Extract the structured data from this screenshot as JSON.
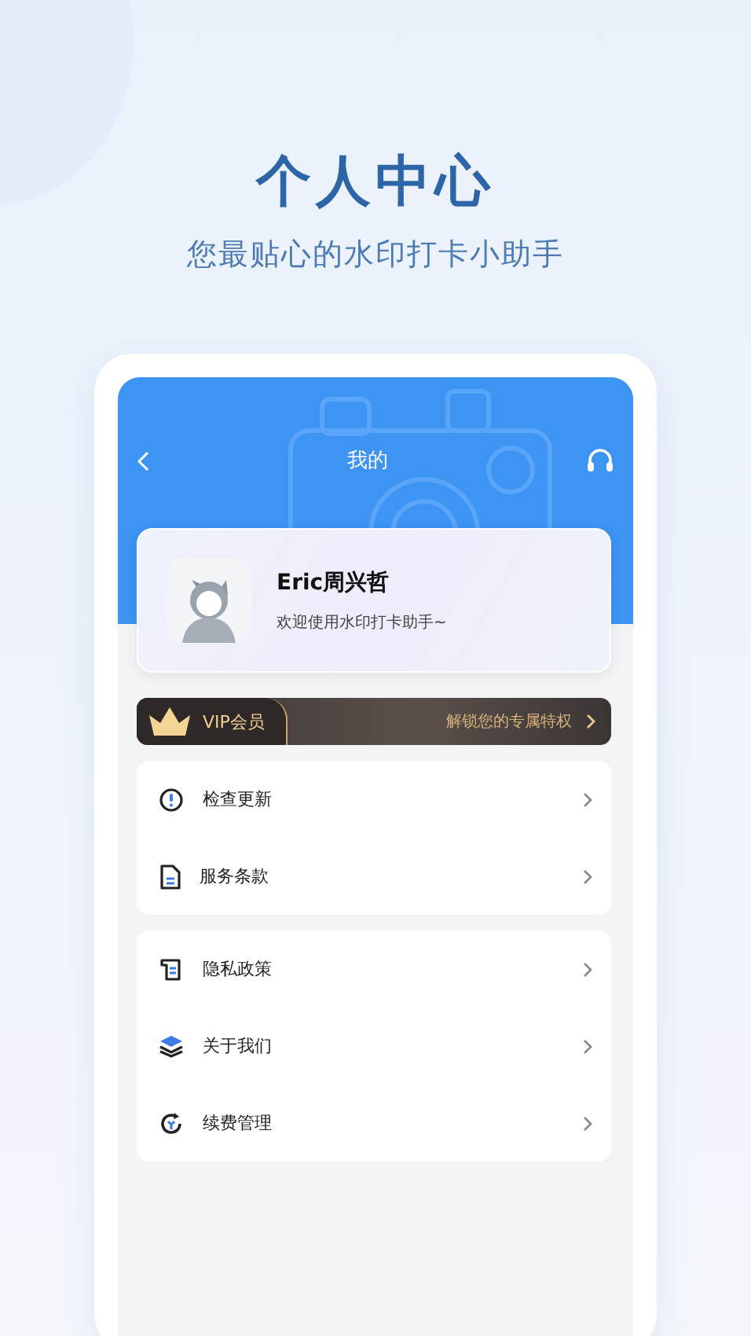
{
  "promo": {
    "title": "个人中心",
    "subtitle": "您最贴心的水印打卡小助手"
  },
  "app_bar": {
    "title": "我的"
  },
  "profile": {
    "name": "Eric周兴哲",
    "greeting": "欢迎使用水印打卡助手~"
  },
  "vip_banner": {
    "badge": "VIP会员",
    "action": "解锁您的专属特权"
  },
  "menu_groups": [
    {
      "items": [
        {
          "kind": "update",
          "label": "检查更新"
        },
        {
          "kind": "terms",
          "label": "服务条款"
        }
      ]
    },
    {
      "items": [
        {
          "kind": "privacy",
          "label": "隐私政策"
        },
        {
          "kind": "about",
          "label": "关于我们"
        },
        {
          "kind": "renew",
          "label": "续费管理"
        }
      ]
    }
  ]
}
